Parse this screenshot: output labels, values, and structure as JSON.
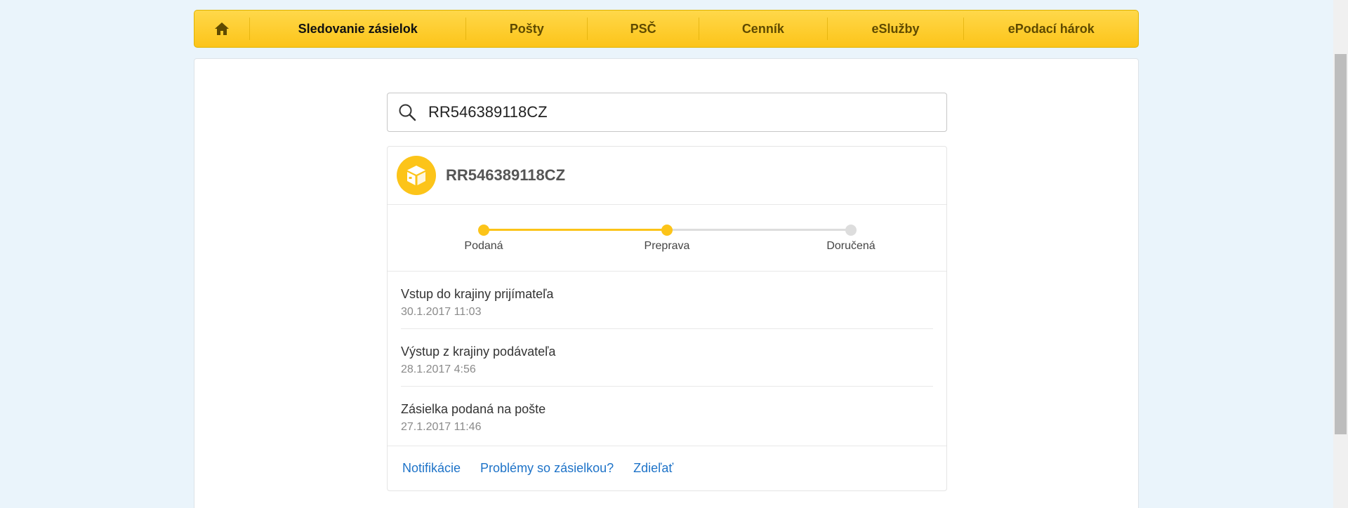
{
  "nav": {
    "home_icon": "home-icon",
    "items": [
      {
        "label": "Sledovanie zásielok",
        "active": true
      },
      {
        "label": "Pošty"
      },
      {
        "label": "PSČ"
      },
      {
        "label": "Cenník"
      },
      {
        "label": "eSlužby"
      },
      {
        "label": "ePodací hárok"
      }
    ]
  },
  "search": {
    "icon": "search-icon",
    "value": "RR546389118CZ"
  },
  "shipment": {
    "icon": "package-icon",
    "tracking_number": "RR546389118CZ",
    "steps": [
      {
        "label": "Podaná",
        "done": true
      },
      {
        "label": "Preprava",
        "done": true
      },
      {
        "label": "Doručená",
        "done": false
      }
    ],
    "events": [
      {
        "title": "Vstup do krajiny prijímateľa",
        "date": "30.1.2017 11:03"
      },
      {
        "title": "Výstup z krajiny podávateľa",
        "date": "28.1.2017 4:56"
      },
      {
        "title": "Zásielka podaná na pošte",
        "date": "27.1.2017 11:46"
      }
    ],
    "links": [
      "Notifikácie",
      "Problémy so zásielkou?",
      "Zdieľať"
    ]
  },
  "colors": {
    "accent": "#fcc419",
    "link": "#1e73c8",
    "inactive": "#dddddd"
  }
}
